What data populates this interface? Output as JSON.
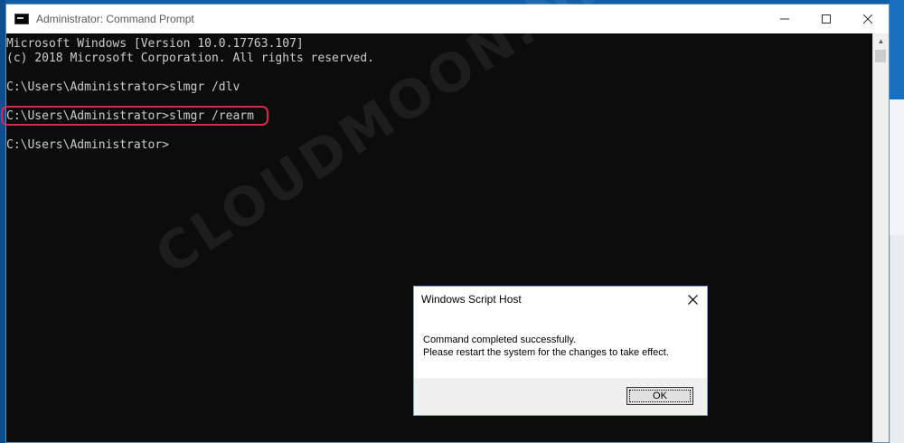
{
  "window": {
    "title": "Administrator: Command Prompt"
  },
  "console": {
    "lines": [
      "Microsoft Windows [Version 10.0.17763.107]",
      "(c) 2018 Microsoft Corporation. All rights reserved.",
      "",
      "C:\\Users\\Administrator>slmgr /dlv",
      "",
      "C:\\Users\\Administrator>slmgr /rearm",
      "",
      "C:\\Users\\Administrator>"
    ]
  },
  "watermark": {
    "text": "CLOUDMOON.NET"
  },
  "dialog": {
    "title": "Windows Script Host",
    "message_line1": "Command completed successfully.",
    "message_line2": "Please restart the system for the changes to take effect.",
    "ok_label": "OK"
  },
  "colors": {
    "console_bg": "#0c0c0c",
    "console_text": "#cccccc",
    "highlight": "#d6294f"
  }
}
